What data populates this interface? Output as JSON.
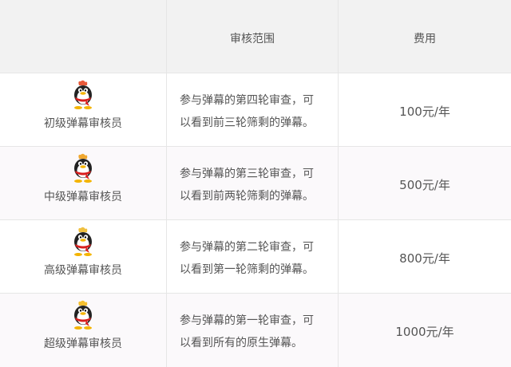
{
  "header": {
    "col_role": "",
    "col_scope": "审核范围",
    "col_fee": "费用"
  },
  "rows": [
    {
      "role": "初级弹幕审核员",
      "desc_line1": "参与弹幕的第四轮审查，可",
      "desc_line2": "以看到前三轮筛剩的弹幕。",
      "fee": "100元/年",
      "icon": "qq-penguin-icon",
      "crown_color": "#e85a3a"
    },
    {
      "role": "中级弹幕审核员",
      "desc_line1": "参与弹幕的第三轮审查，可",
      "desc_line2": "以看到前两轮筛剩的弹幕。",
      "fee": "500元/年",
      "icon": "qq-penguin-icon",
      "crown_color": "#f0a830"
    },
    {
      "role": "高级弹幕审核员",
      "desc_line1": "参与弹幕的第二轮审查，可",
      "desc_line2": "以看到第一轮筛剩的弹幕。",
      "fee": "800元/年",
      "icon": "qq-penguin-icon",
      "crown_color": "#f0c040"
    },
    {
      "role": "超级弹幕审核员",
      "desc_line1": "参与弹幕的第一轮审查，可",
      "desc_line2": "以看到所有的原生弹幕。",
      "fee": "1000元/年",
      "icon": "qq-penguin-icon",
      "crown_color": "#f5c030"
    }
  ]
}
